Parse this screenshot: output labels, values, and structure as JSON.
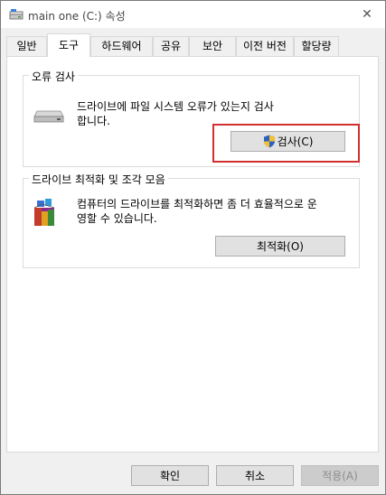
{
  "window": {
    "title": "main one (C:) 속성",
    "close_symbol": "✕"
  },
  "tabs": [
    {
      "label": "일반"
    },
    {
      "label": "도구"
    },
    {
      "label": "하드웨어"
    },
    {
      "label": "공유"
    },
    {
      "label": "보안"
    },
    {
      "label": "이전 버전"
    },
    {
      "label": "할당량"
    }
  ],
  "active_tab": "도구",
  "error_check": {
    "title": "오류 검사",
    "desc_line1": "드라이브에 파일 시스템 오류가 있는지 검사",
    "desc_line2": "합니다.",
    "button_label": "검사(C)",
    "icons": [
      "drive-icon",
      "uac-shield-icon"
    ]
  },
  "optimize": {
    "title": "드라이브 최적화 및 조각 모음",
    "desc_line1": "컴퓨터의 드라이브를 최적화하면 좀 더 효율적으로 운",
    "desc_line2": "영할 수 있습니다.",
    "button_label": "최적화(O)",
    "icons": [
      "defrag-icon"
    ]
  },
  "footer": {
    "ok_label": "확인",
    "cancel_label": "취소",
    "apply_label": "적용(A)"
  },
  "colors": {
    "highlight": "#d32f2f",
    "window_bg": "#f0f0f0"
  }
}
